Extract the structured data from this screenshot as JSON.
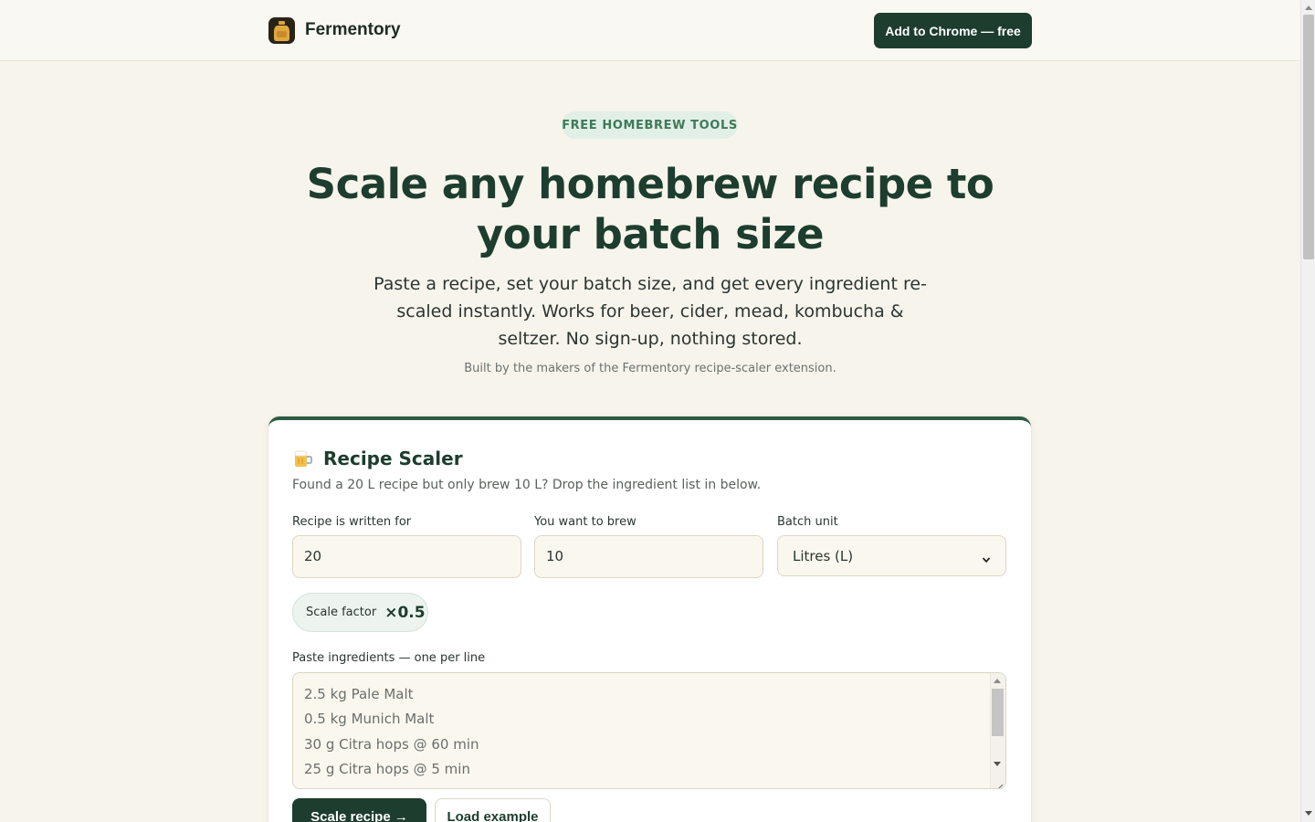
{
  "header": {
    "brand_name": "Fermentory",
    "cta_label": "Add to Chrome — free"
  },
  "hero": {
    "pill": "FREE HOMEBREW TOOLS",
    "title": "Scale any homebrew recipe to your batch size",
    "subtitle": "Paste a recipe, set your batch size, and get every ingredient re-scaled instantly. Works for beer, cider, mead, kombucha & seltzer. No sign-up, nothing stored.",
    "note": "Built by the makers of the Fermentory recipe-scaler extension."
  },
  "scaler": {
    "icon": "beer-mug-icon",
    "title": "Recipe Scaler",
    "description": "Found a 20 L recipe but only brew 10 L? Drop the ingredient list in below.",
    "written_for_label": "Recipe is written for",
    "written_for_value": "20",
    "want_label": "You want to brew",
    "want_value": "10",
    "unit_label": "Batch unit",
    "unit_value": "Litres (L)",
    "scale_factor_label": "Scale factor",
    "scale_factor_value": "×0.5",
    "ingredients_label": "Paste ingredients — one per line",
    "ingredients": [
      "2.5 kg Pale Malt",
      "0.5 kg Munich Malt",
      "30 g Citra hops @ 60 min",
      "25 g Citra hops @ 5 min"
    ],
    "scale_button": "Scale recipe →",
    "example_button": "Load example"
  },
  "colors": {
    "brand_dark": "#1d3d2e",
    "background": "#f7f4ec",
    "pill_bg": "#e2efe6",
    "pill_text": "#3e7a57"
  }
}
